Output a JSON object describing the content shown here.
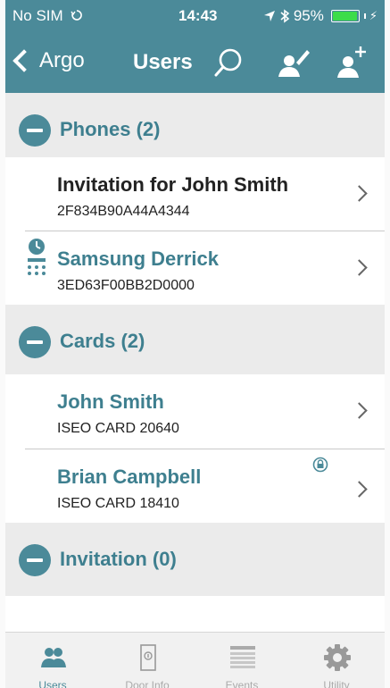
{
  "status_bar": {
    "carrier": "No SIM",
    "time": "14:43",
    "battery": "95%",
    "battery_level": 0.95
  },
  "nav": {
    "back_label": "Argo",
    "title": "Users",
    "icons": [
      "search-icon",
      "edit-user-icon",
      "add-user-icon"
    ]
  },
  "sections": {
    "phones": {
      "title": "Phones (2)",
      "rows": [
        {
          "name": "Invitation for John Smith",
          "id": "2F834B90A44A4344"
        },
        {
          "name": "Samsung Derrick",
          "id": "3ED63F00BB2D0000",
          "icon": "clock-keypad-icon"
        }
      ]
    },
    "cards": {
      "title": "Cards (2)",
      "rows": [
        {
          "name": "John Smith",
          "id": "ISEO CARD 20640"
        },
        {
          "name": "Brian Campbell",
          "id": "ISEO CARD 18410",
          "icon": "lock-icon"
        }
      ]
    },
    "invitation": {
      "title": "Invitation (0)"
    }
  },
  "tab_bar": {
    "tabs": [
      {
        "label": "Users",
        "icon": "users-icon",
        "active": true
      },
      {
        "label": "Door Info",
        "icon": "door-icon"
      },
      {
        "label": "Events",
        "icon": "events-list-icon"
      },
      {
        "label": "Utility",
        "icon": "gear-icon"
      }
    ]
  },
  "colors": {
    "accent": "#4b8a99",
    "section_bg": "#ebebeb",
    "teal_text": "#3e7f8f"
  }
}
